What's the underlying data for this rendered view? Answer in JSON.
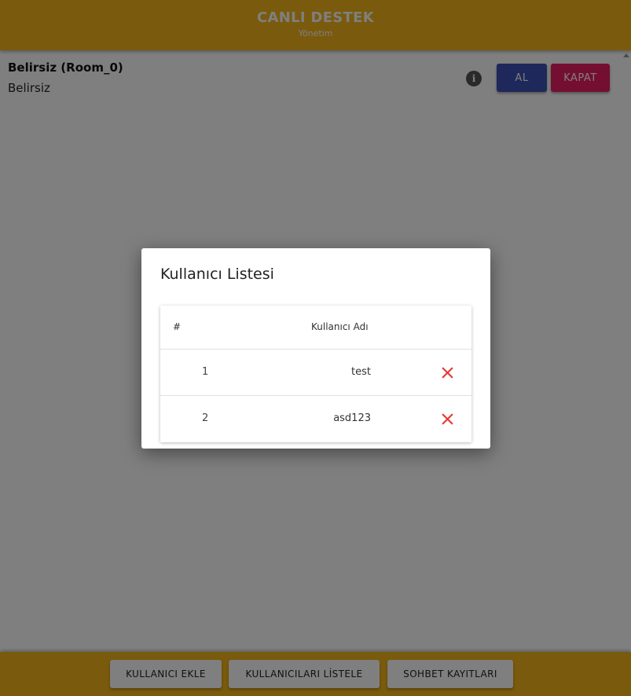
{
  "header": {
    "title": "CANLI DESTEK",
    "subtitle": "Yönetim"
  },
  "room": {
    "title": "Belirsiz (Room_0)",
    "status": "Belirsiz",
    "info_icon": "i",
    "take_label": "AL",
    "close_label": "KAPAT"
  },
  "footer": {
    "add_user_label": "KULLANICI EKLE",
    "list_users_label": "KULLANICILARI LİSTELE",
    "chat_logs_label": "SOHBET KAYITLARI"
  },
  "modal": {
    "title": "Kullanıcı Listesi",
    "table": {
      "col_num": "#",
      "col_user": "Kullanıcı Adı",
      "rows": [
        {
          "num": "1",
          "username": "test"
        },
        {
          "num": "2",
          "username": "asd123"
        }
      ]
    }
  },
  "colors": {
    "header_bg": "#f4b41a",
    "take_btn": "#3f51b5",
    "close_btn": "#e91e63",
    "delete_icon": "#e53935"
  },
  "icons": {
    "info": "info-icon",
    "delete": "close-icon"
  }
}
